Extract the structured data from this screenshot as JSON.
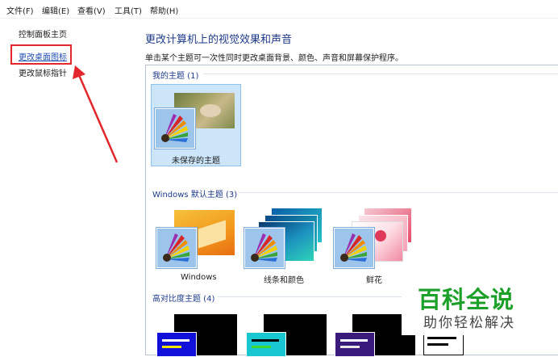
{
  "menubar": {
    "items": [
      "文件(F)",
      "编辑(E)",
      "查看(V)",
      "工具(T)",
      "帮助(H)"
    ]
  },
  "sidebar": {
    "items": [
      {
        "label": "控制面板主页"
      },
      {
        "label": "更改桌面图标"
      },
      {
        "label": "更改鼠标指针"
      }
    ]
  },
  "main": {
    "title": "更改计算机上的视觉效果和声音",
    "description": "单击某个主题可一次性同时更改桌面背景、颜色、声音和屏幕保护程序。",
    "groups": [
      {
        "header": "我的主题 (1)",
        "themes": [
          {
            "label": "未保存的主题"
          }
        ]
      },
      {
        "header": "Windows 默认主题 (3)",
        "themes": [
          {
            "label": "Windows"
          },
          {
            "label": "线条和颜色"
          },
          {
            "label": "鲜花"
          }
        ]
      },
      {
        "header": "高对比度主题 (4)",
        "themes": []
      }
    ]
  },
  "watermark": {
    "title": "百科全说",
    "subtitle": "助你轻松解决"
  },
  "colors": {
    "link": "#1f4fb0",
    "heading": "#1e3a8a",
    "highlight": "#e2262c",
    "selected_bg": "#cce5f8",
    "watermark_green": "#1da02a"
  }
}
